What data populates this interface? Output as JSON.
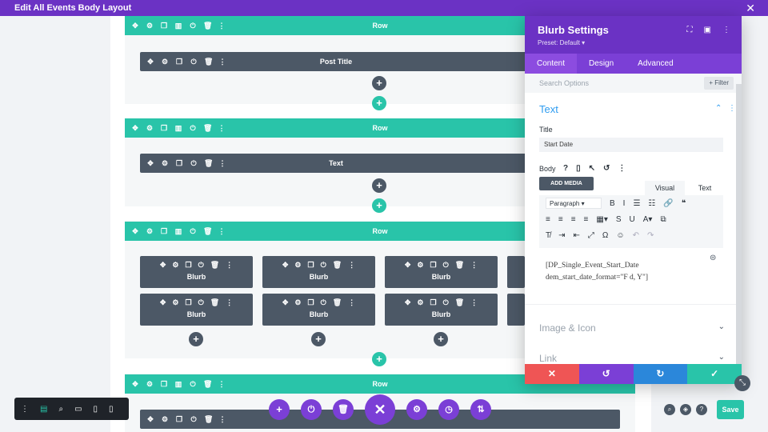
{
  "app": {
    "title": "Edit All Events Body Layout",
    "close": "✕"
  },
  "canvas": {
    "row_label": "Row",
    "rows": [
      {
        "label": "Row"
      },
      {
        "label": "Row"
      },
      {
        "label": "Row"
      },
      {
        "label": "Row"
      }
    ],
    "modules": {
      "post_title": "Post Title",
      "text": "Text",
      "blurb": "Blurb"
    },
    "tool_icons": [
      "✥",
      "⚙",
      "❐",
      "▥",
      "⏻",
      "🗑",
      "⋮"
    ],
    "module_tool_icons": [
      "✥",
      "⚙",
      "❐",
      "⏻",
      "🗑",
      "⋮"
    ],
    "add": "+"
  },
  "panel": {
    "title": "Blurb Settings",
    "preset": "Preset: Default ▾",
    "header_icons": [
      "⛶",
      "▣",
      "⋮"
    ],
    "tabs": [
      "Content",
      "Design",
      "Advanced"
    ],
    "search_placeholder": "Search Options",
    "filter": "+ Filter",
    "section_text": "Text",
    "title_label": "Title",
    "title_value": "Start Date",
    "body_label": "Body",
    "body_tools": [
      "?",
      "▯",
      "↖",
      "↺",
      "⋮"
    ],
    "add_media": "ADD MEDIA",
    "visual_tab": "Visual",
    "text_tab": "Text",
    "paragraph": "Paragraph",
    "toolbar_row1": [
      "B",
      "I",
      "☰",
      "☷",
      "🔗",
      "❝"
    ],
    "toolbar_row2": [
      "≡",
      "≡",
      "≡",
      "≡",
      "▦▾",
      "S",
      "U",
      "A▾",
      "⧉"
    ],
    "toolbar_row3": [
      "T̸",
      "⇥",
      "⇤",
      "⤢",
      "Ω",
      "☺",
      "↶",
      "↷"
    ],
    "content_line1": "[DP_Single_Event_Start_Date",
    "content_line2": "dem_start_date_format=\"F d, Y\"]",
    "section_image": "Image & Icon",
    "section_link": "Link",
    "chev_down": "⌄",
    "chev_up": "⌃",
    "footer": {
      "cancel": "✕",
      "undo": "↺",
      "redo": "↻",
      "save": "✓"
    }
  },
  "bottom": {
    "left_tools": [
      "⋮",
      "▤",
      "⌕",
      "▭",
      "▯",
      "▯"
    ],
    "fab_icons": [
      "+",
      "⏻",
      "🗑",
      "✕",
      "⚙",
      "◷",
      "⇅"
    ],
    "right_icons": [
      "⌕",
      "◈",
      "?"
    ],
    "save": "Save",
    "resize": "⤡"
  },
  "colors": {
    "purple": "#6b32c4",
    "teal": "#29c4a9",
    "slate": "#4c5866",
    "red": "#ef5555",
    "blue": "#2b87da",
    "green": "#29c4a9",
    "violet": "#7b3fd6"
  }
}
